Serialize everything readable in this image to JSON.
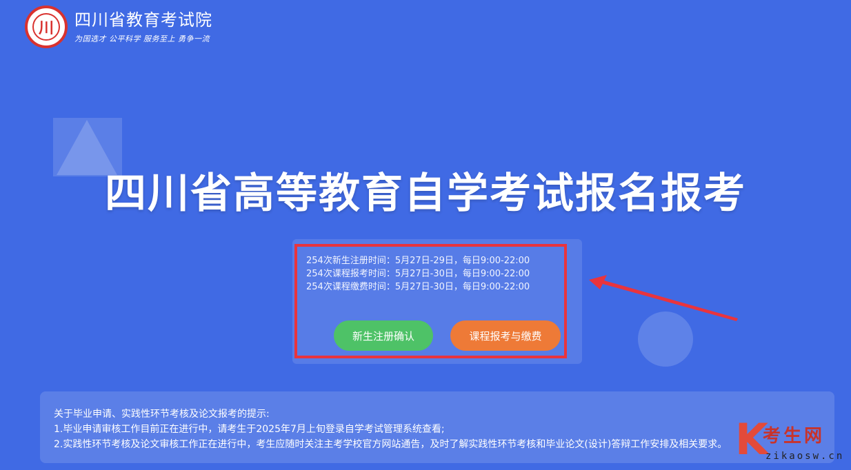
{
  "header": {
    "logo_glyph": "川",
    "name": "四川省教育考试院",
    "slogan": "为国选才  公平科学  服务至上  勇争一流"
  },
  "main": {
    "title": "四川省高等教育自学考试报名报考"
  },
  "schedule": {
    "lines": [
      "254次新生注册时间：5月27日-29日，每日9:00-22:00",
      "254次课程报考时间：5月27日-30日，每日9:00-22:00",
      "254次课程缴费时间：5月27日-30日，每日9:00-22:00"
    ]
  },
  "buttons": {
    "register": "新生注册确认",
    "apply": "课程报考与缴费"
  },
  "notice": {
    "lines": [
      "关于毕业申请、实践性环节考核及论文报考的提示:",
      "1.毕业申请审核工作目前正在进行中，请考生于2025年7月上旬登录自学考试管理系统查看;",
      "2.实践性环节考核及论文审核工作正在进行中，考生应随时关注主考学校官方网站通告，及时了解实践性环节考核和毕业论文(设计)答辩工作安排及相关要求。"
    ]
  },
  "watermark": {
    "letter": "K",
    "text": "考生网",
    "url": "zikaosw.cn"
  },
  "colors": {
    "background": "#406ae4",
    "highlight_border": "#e9343d",
    "register_button": "#4ec267",
    "apply_button": "#ee7a37"
  }
}
